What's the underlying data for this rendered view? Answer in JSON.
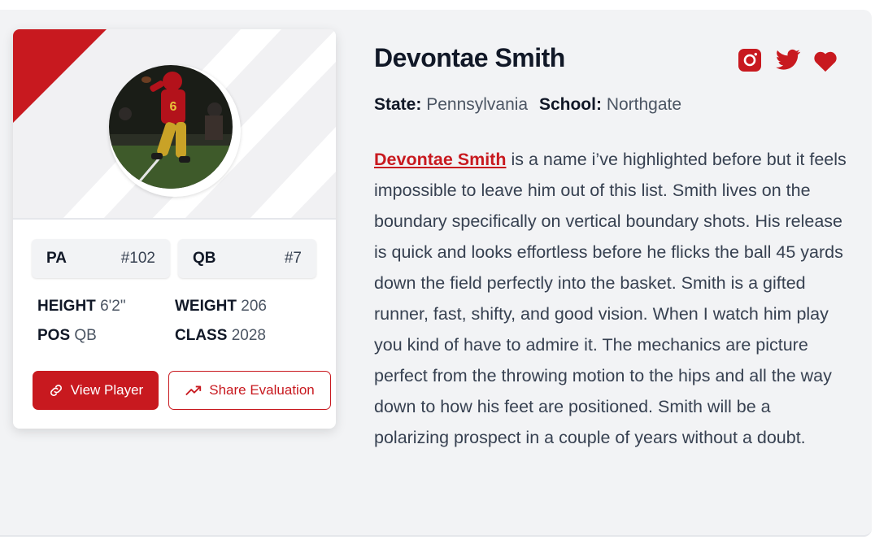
{
  "player": {
    "name": "Devontae Smith",
    "state_label": "State:",
    "state": "Pennsylvania",
    "school_label": "School:",
    "school": "Northgate"
  },
  "card": {
    "chip_state": "PA",
    "chip_rank": "#102",
    "chip_position": "QB",
    "chip_number": "#7",
    "height_label": "HEIGHT",
    "height": "6'2\"",
    "weight_label": "WEIGHT",
    "weight": "206",
    "pos_label": "POS",
    "pos": "QB",
    "class_label": "CLASS",
    "class": "2028",
    "view_button": "View Player",
    "share_button": "Share Evaluation"
  },
  "bio": {
    "link_text": "Devontae Smith",
    "text": " is a name i’ve highlighted before but it feels impossible to leave him out of this list. Smith lives on the boundary specifically on vertical boundary shots. His release is quick and looks effortless before he flicks the ball 45 yards down the field perfectly into the basket. Smith is a gifted runner, fast, shifty, and good vision. When I watch him play you kind of have to admire it. The mechanics are picture perfect from the throwing motion to the hips and all the way down to how his feet are positioned. Smith will be a polarizing prospect in a couple of years without a doubt."
  },
  "icons": [
    "instagram-icon",
    "twitter-icon",
    "heart-icon",
    "link-icon",
    "trending-up-icon"
  ],
  "colors": {
    "accent": "#c8191f",
    "background": "#f2f3f5",
    "card": "#ffffff"
  }
}
